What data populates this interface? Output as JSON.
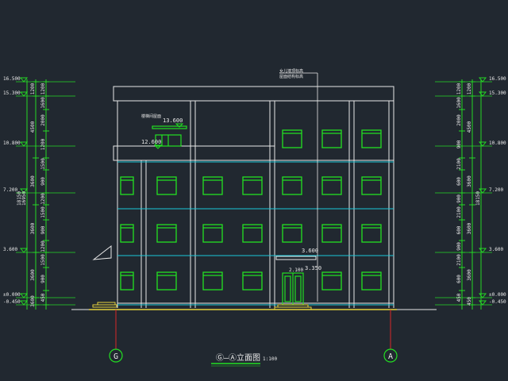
{
  "colors": {
    "background": "#212830",
    "line_white": "#e8e8e8",
    "window_green": "#22e022",
    "glass_cyan": "#19c9d9",
    "dim_green": "#25d925",
    "ground_yellow": "#e6d23c",
    "axis_red": "#d62828"
  },
  "drawing": {
    "title": "Ⓖ—Ⓐ立面图",
    "scale": "1:100",
    "note_top": "女儿墙顶标高",
    "note_top_line2": "屋面结构标高",
    "note_stair": "楼梯间屋面",
    "levels_inside": {
      "roof_stair": "13.600",
      "roof_main": "12.600",
      "canopy": "3.600",
      "door_head": "2.100",
      "door_level2": "3.350"
    }
  },
  "axes": {
    "left": "G",
    "right": "A"
  },
  "left_levels": [
    "16.500",
    "15.300",
    "10.800",
    "7.200",
    "3.600",
    "±0.000",
    "-0.450"
  ],
  "right_levels": [
    "16.500",
    "15.300",
    "10.800",
    "7.200",
    "3.600",
    "±0.000",
    "-0.450"
  ],
  "left_dims_inner": [
    "1200",
    "1600",
    "2000",
    "1200",
    "1500",
    "900",
    "1200",
    "1500",
    "900",
    "1200",
    "1500",
    "900",
    "450"
  ],
  "left_dims_mid": [
    "1200",
    "4500",
    "3600",
    "3600",
    "3600",
    "3600",
    "450"
  ],
  "left_dims_total": [
    "16950",
    "18150"
  ],
  "right_dims_inner": [
    "1200",
    "1600",
    "2000",
    "900",
    "2100",
    "600",
    "900",
    "2100",
    "600",
    "900",
    "2100",
    "600",
    "450"
  ],
  "right_dims_mid": [
    "1200",
    "4500",
    "3600",
    "3600",
    "3600",
    "450"
  ],
  "right_dims_total": [
    "18150"
  ]
}
